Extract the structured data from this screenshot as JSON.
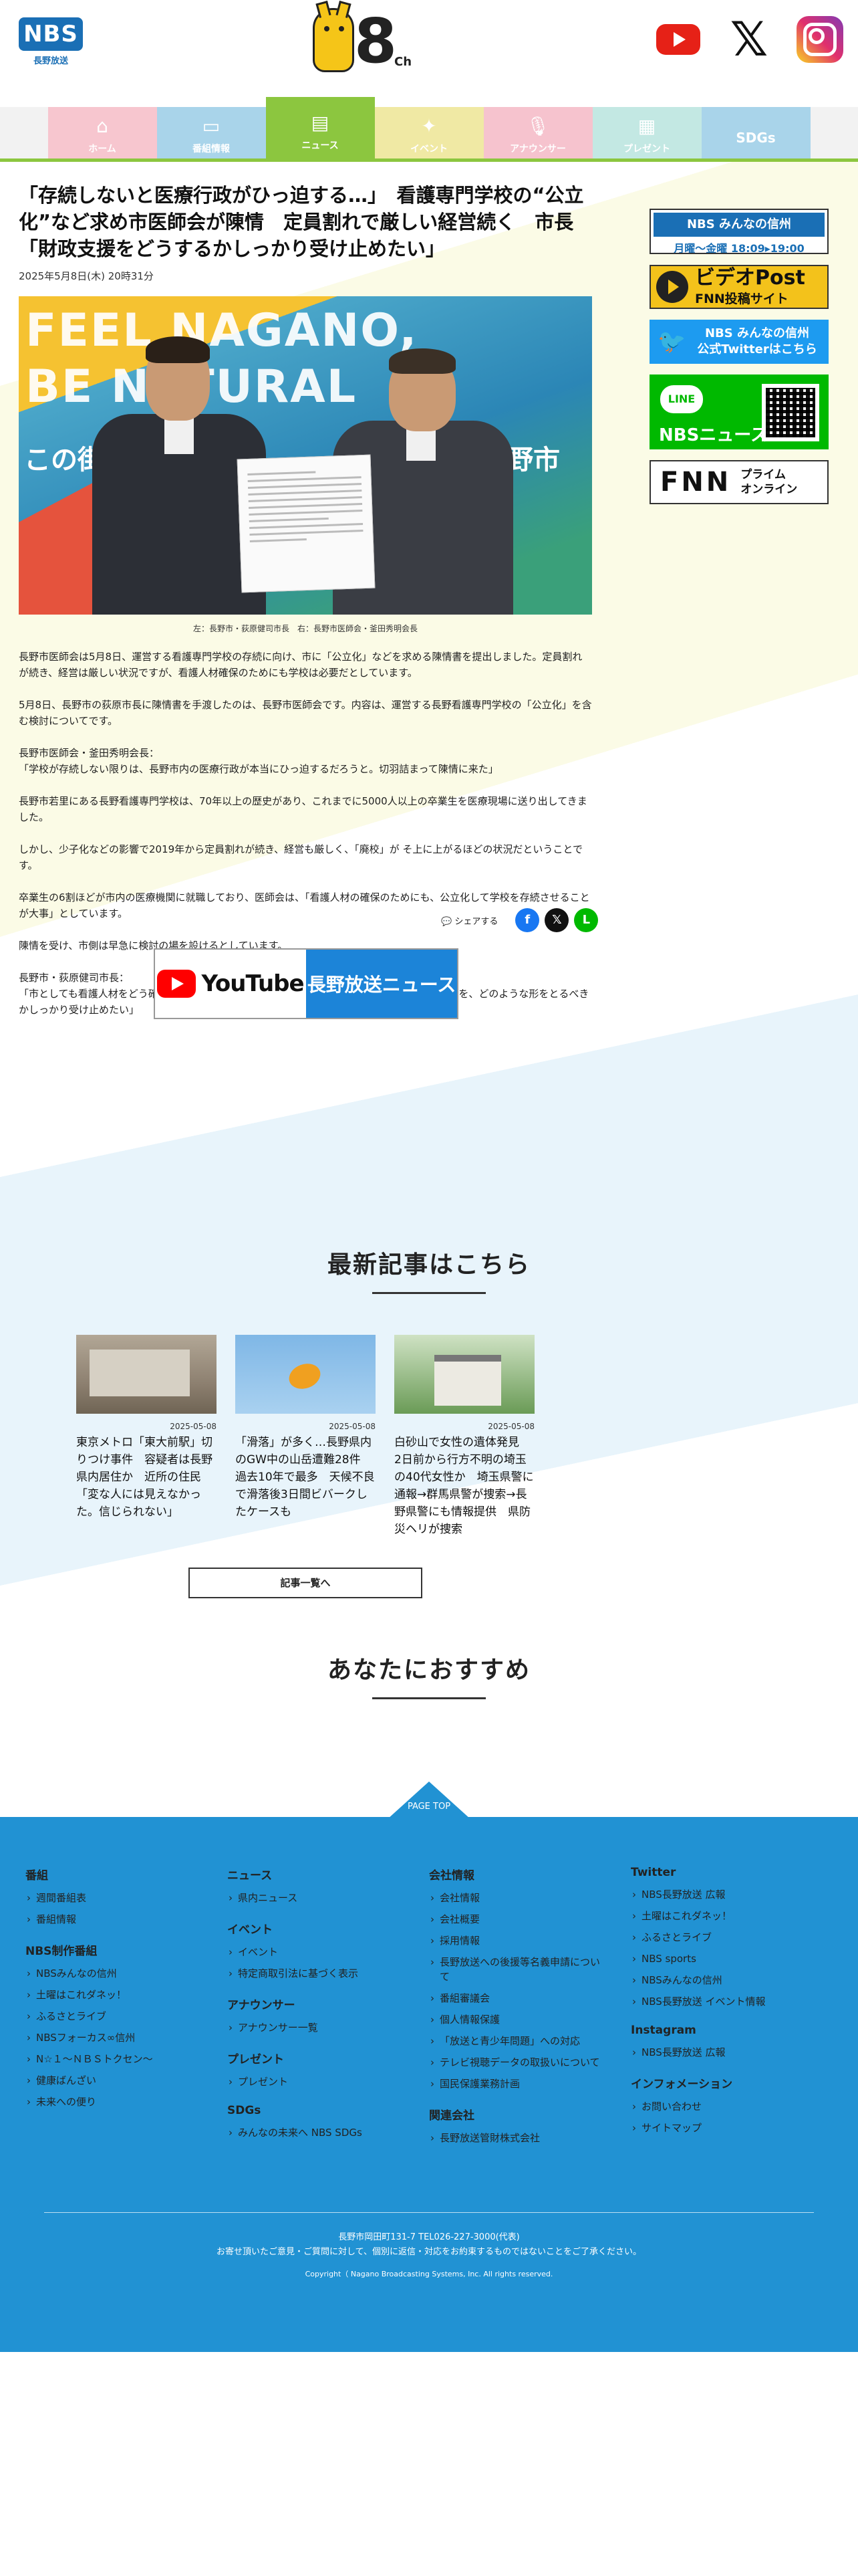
{
  "header": {
    "logo_text": "NBS",
    "logo_sub": "長野放送",
    "channel_number": "8",
    "channel_suffix": "Ch",
    "social": [
      "youtube-icon",
      "x-icon",
      "instagram-icon"
    ]
  },
  "nav": {
    "items": [
      {
        "label": "ホーム",
        "icon": "home-icon",
        "color": "#f7c6cf"
      },
      {
        "label": "番組情報",
        "icon": "tv-icon",
        "color": "#a9d4ea"
      },
      {
        "label": "ニュース",
        "icon": "news-icon",
        "color": "#8cc63f"
      },
      {
        "label": "イベント",
        "icon": "event-icon",
        "color": "#f0e9a4"
      },
      {
        "label": "アナウンサー",
        "icon": "mic-icon",
        "color": "#f6c3ce"
      },
      {
        "label": "プレゼント",
        "icon": "gift-icon",
        "color": "#c3e8e3"
      },
      {
        "label": "SDGs",
        "icon": "sdgs-icon",
        "color": "#a9d4ea"
      }
    ],
    "active_index": 2
  },
  "article": {
    "title": "「存続しないと医療行政がひっ迫する…」　看護専門学校の“公立化”など求め市医師会が陳情　定員割れで厳しい経営続く　市長「財政支援をどうするかしっかり受け止めたい」",
    "date": "2025年5月8日(木) 20時31分",
    "photo_bg_text_1": "FEEL NAGANO,",
    "photo_bg_text_2": "BE NATURAL",
    "photo_bg_text_3": "この街",
    "photo_bg_text_4": "野市",
    "caption": "左：長野市・荻原健司市長　右：長野市医師会・釜田秀明会長",
    "paragraphs": [
      "長野市医師会は5月8日、運営する看護専門学校の存続に向け、市に「公立化」などを求める陳情書を提出しました。定員割れが続き、経営は厳しい状況ですが、看護人材確保のためにも学校は必要だとしています。",
      "5月8日、長野市の荻原市長に陳情書を手渡したのは、長野市医師会です。内容は、運営する長野看護専門学校の「公立化」を含む検討についてです。",
      "長野市医師会・釜田秀明会長：\n「学校が存続しない限りは、長野市内の医療行政が本当にひっ迫するだろうと。切羽詰まって陳情に来た」",
      "長野市若里にある長野看護専門学校は、70年以上の歴史があり、これまでに5000人以上の卒業生を医療現場に送り出してきました。",
      "しかし、少子化などの影響で2019年から定員割れが続き、経営も厳しく、「廃校」が そ上に上がるほどの状況だということです。",
      "卒業生の6割ほどが市内の医療機関に就職しており、医師会は、「看護人材の確保のためにも、公立化して学校を存続させることが大事」としています。",
      "陳情を受け、市側は早急に検討の場を設けるとしています。",
      "長野市・荻原健司市長：\n「市としても看護人材をどう確保していくか非常に大きな課題。学校が存続する上での財政的支援を、どのような形をとるべきかしっかり受け止めたい」"
    ]
  },
  "sidebar": {
    "b1_top": "NBS みんなの信州",
    "b1_bottom": "月曜～金曜 18:09▸19:00",
    "b2_l1": "ビデオPost",
    "b2_l2": "FNN投稿サイト",
    "b3_text": "NBS みんなの信州\n公式Twitterはこちら",
    "b4_line": "LINE",
    "b4_news": "NBSニュース",
    "b5_fnn": "FNN",
    "b5_prime": "プライム\nオンライン"
  },
  "share": {
    "label": "シェアする",
    "facebook": "f",
    "x": "𝕏",
    "line": "L"
  },
  "youtube_banner": {
    "yt_text": "YouTube",
    "right_text": "長野放送ニュース"
  },
  "latest": {
    "title": "最新記事はこちら",
    "items": [
      {
        "date": "2025-05-08",
        "title": "東京メトロ「東大前駅」切りつけ事件　容疑者は長野県内居住か　近所の住民「変な人には見えなかった。信じられない」"
      },
      {
        "date": "2025-05-08",
        "title": "「滑落」が多く…長野県内のGW中の山岳遭難28件　過去10年で最多　天候不良で滑落後3日間ビバークしたケースも"
      },
      {
        "date": "2025-05-08",
        "title": "白砂山で女性の遺体発見　2日前から行方不明の埼玉の40代女性か　埼玉県警に通報→群馬県警が捜索→長野県警にも情報提供　県防災ヘリが捜索"
      }
    ],
    "all_button": "記事一覧へ"
  },
  "recommend": {
    "title": "あなたにおすすめ"
  },
  "footer": {
    "page_top": "PAGE TOP",
    "col1": [
      {
        "heading": "番組",
        "links": [
          "週間番組表",
          "番組情報"
        ]
      },
      {
        "heading": "NBS制作番組",
        "links": [
          "NBSみんなの信州",
          "土曜はこれダネッ！",
          "ふるさとライブ",
          "NBSフォーカス∞信州",
          "N☆１～ＮＢＳトクセン～",
          "健康ばんざい",
          "未来への便り"
        ]
      }
    ],
    "col2": [
      {
        "heading": "ニュース",
        "links": [
          "県内ニュース"
        ]
      },
      {
        "heading": "イベント",
        "links": [
          "イベント",
          "特定商取引法に基づく表示"
        ]
      },
      {
        "heading": "アナウンサー",
        "links": [
          "アナウンサー一覧"
        ]
      },
      {
        "heading": "プレゼント",
        "links": [
          "プレゼント"
        ]
      },
      {
        "heading": "SDGs",
        "links": [
          "みんなの未来へ NBS SDGs"
        ]
      }
    ],
    "col3": [
      {
        "heading": "会社情報",
        "links": [
          "会社情報",
          "会社概要",
          "採用情報",
          "長野放送への後援等名義申請について",
          "番組審議会",
          "個人情報保護",
          "「放送と青少年問題」への対応",
          "テレビ視聴データの取扱いについて",
          "国民保護業務計画"
        ]
      },
      {
        "heading": "関連会社",
        "links": [
          "長野放送管財株式会社"
        ]
      }
    ],
    "col4": [
      {
        "heading": "Twitter",
        "links": [
          "NBS長野放送 広報",
          "土曜はこれダネッ！",
          "ふるさとライブ",
          "NBS sports",
          "NBSみんなの信州",
          "NBS長野放送 イベント情報"
        ]
      },
      {
        "heading": "Instagram",
        "links": [
          "NBS長野放送 広報"
        ]
      },
      {
        "heading": "インフォメーション",
        "links": [
          "お問い合わせ",
          "サイトマップ"
        ]
      }
    ],
    "address": "長野市岡田町131-7 TEL026-227-3000(代表)",
    "notice": "お寄せ頂いたご意見・ご質問に対して、個別に返信・対応をお約束するものではないことをご了承ください。",
    "copyright": "Copyright（ Nagano Broadcasting Systems, Inc. All rights reserved."
  }
}
